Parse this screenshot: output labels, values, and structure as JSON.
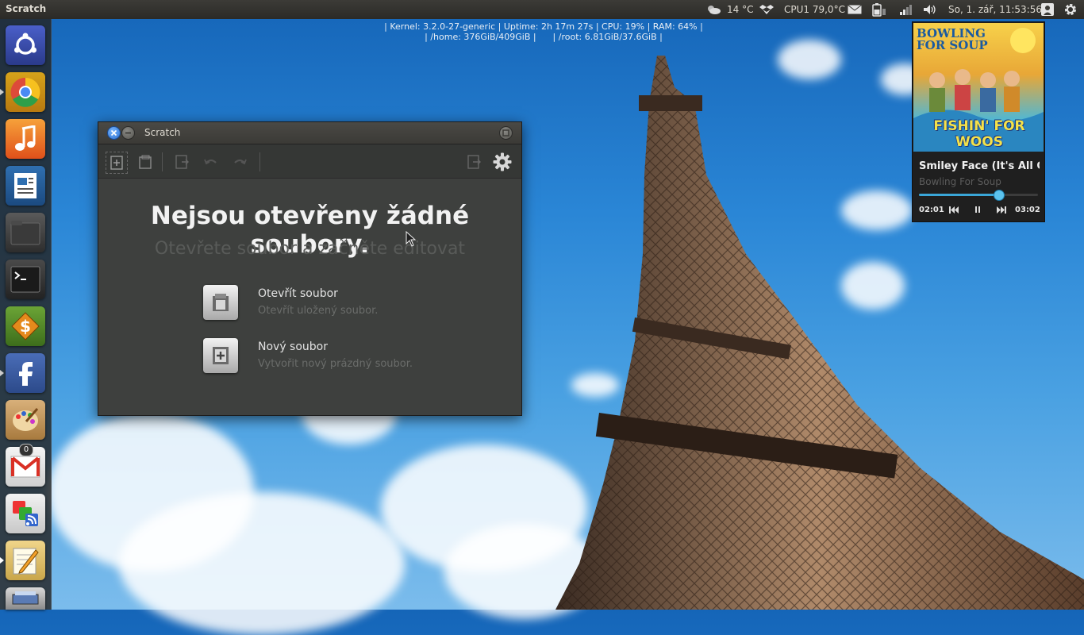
{
  "panel": {
    "app_title": "Scratch",
    "weather": "14 °C",
    "cpu_temp": "CPU1 79,0°C",
    "datetime": "So, 1. zář, 11:53:56"
  },
  "conky": {
    "line1": "| Kernel: 3.2.0-27-generic | Uptime: 2h 17m 27s | CPU: 19% | RAM: 64% |",
    "line2": "| /home: 376GiB/409GiB |      | /root: 6.81GiB/37.6GiB |"
  },
  "launcher": {
    "items": [
      {
        "name": "ubuntu-dash"
      },
      {
        "name": "chrome"
      },
      {
        "name": "music-player"
      },
      {
        "name": "libreoffice-writer"
      },
      {
        "name": "files"
      },
      {
        "name": "terminal"
      },
      {
        "name": "finance"
      },
      {
        "name": "facebook"
      },
      {
        "name": "paint"
      },
      {
        "name": "gmail",
        "badge": "0"
      },
      {
        "name": "rss-reader"
      },
      {
        "name": "scratch"
      },
      {
        "name": "scanner"
      }
    ]
  },
  "window": {
    "title": "Scratch",
    "welcome_title": "Nejsou otevřeny žádné soubory.",
    "welcome_subtitle": "Otevřete soubor a začněte editovat",
    "actions": [
      {
        "title": "Otevřít soubor",
        "desc": "Otevřít uložený soubor."
      },
      {
        "title": "Nový soubor",
        "desc": "Vytvořit nový prázdný soubor."
      }
    ]
  },
  "music": {
    "album_text_top": "BOWLING FOR SOUP",
    "album_text_bottom": "FISHIN' FOR WOOS",
    "song_title": "Smiley Face (It's All G",
    "artist": "Bowling For Soup",
    "elapsed": "02:01",
    "total": "03:02",
    "progress": 0.665,
    "accent": "#3aa6d8"
  }
}
